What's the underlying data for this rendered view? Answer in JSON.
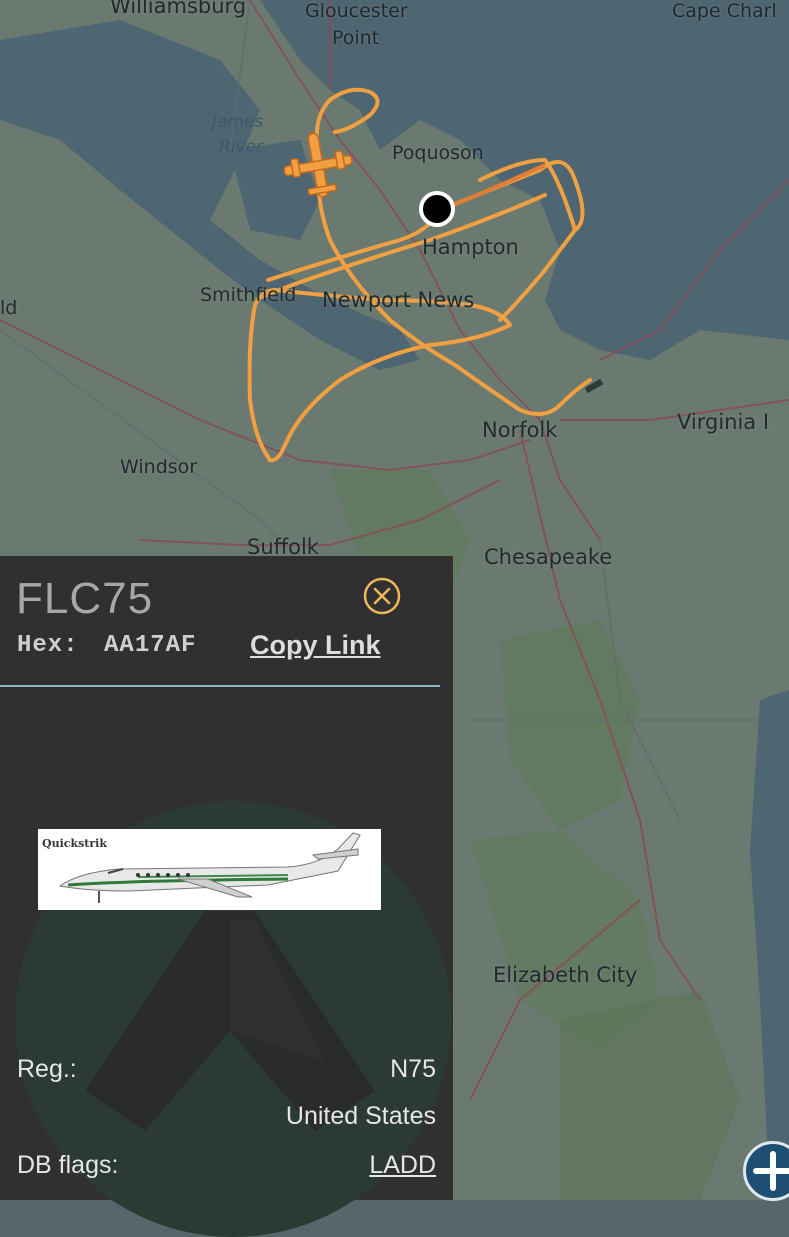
{
  "map": {
    "places": {
      "williamsburg": "Williamsburg",
      "gloucester_point_1": "Gloucester",
      "gloucester_point_2": "Point",
      "cape_charles": "Cape Charl",
      "james_river_1": "James",
      "james_river_2": "River",
      "poquoson": "Poquoson",
      "hampton": "Hampton",
      "smithfield": "Smithfield",
      "newport_news": "Newport News",
      "isle_fragment": "ld",
      "norfolk": "Norfolk",
      "virginia_beach": "Virginia I",
      "windsor": "Windsor",
      "suffolk": "Suffolk",
      "chesapeake": "Chesapeake",
      "elizabeth_city": "Elizabeth City"
    },
    "track_color": "#f0a040",
    "icon": "airplane-icon"
  },
  "aircraft": {
    "callsign": "FLC75",
    "hex_label": "Hex:",
    "hex": "AA17AF",
    "copy_link": "Copy Link",
    "photo_caption": "Quickstrik",
    "reg_label": "Reg.:",
    "reg": "N75",
    "country": "United States",
    "db_flags_label": "DB flags:",
    "db_flags": "LADD"
  },
  "controls": {
    "close_icon": "close-circle-icon",
    "zoom_icon": "plus-icon"
  }
}
